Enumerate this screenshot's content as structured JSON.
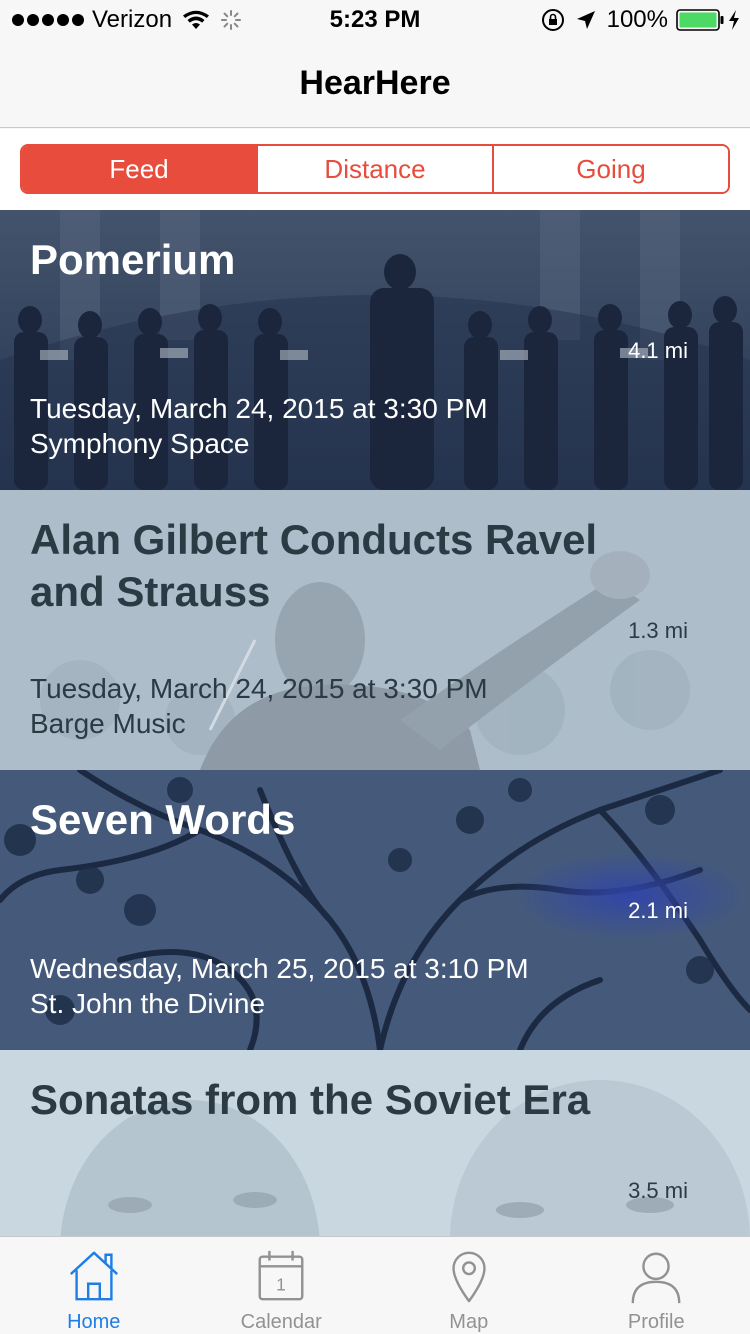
{
  "status_bar": {
    "carrier": "Verizon",
    "time": "5:23 PM",
    "battery": "100%"
  },
  "nav": {
    "title": "HearHere"
  },
  "segments": [
    {
      "label": "Feed",
      "selected": true
    },
    {
      "label": "Distance",
      "selected": false
    },
    {
      "label": "Going",
      "selected": false
    }
  ],
  "events": [
    {
      "title": "Pomerium",
      "distance": "4.1 mi",
      "date": "Tuesday, March 24, 2015 at 3:30 PM",
      "venue": "Symphony Space"
    },
    {
      "title": "Alan Gilbert Conducts Ravel and Strauss",
      "distance": "1.3 mi",
      "date": "Tuesday, March 24, 2015 at 3:30 PM",
      "venue": "Barge Music"
    },
    {
      "title": "Seven Words",
      "distance": "2.1 mi",
      "date": "Wednesday, March 25, 2015 at 3:10 PM",
      "venue": "St. John the Divine"
    },
    {
      "title": "Sonatas from the Soviet Era",
      "distance": "3.5 mi",
      "date": "",
      "venue": ""
    }
  ],
  "tabs": [
    {
      "label": "Home",
      "icon": "home-icon",
      "active": true
    },
    {
      "label": "Calendar",
      "icon": "calendar-icon",
      "active": false,
      "icon_text": "1"
    },
    {
      "label": "Map",
      "icon": "map-pin-icon",
      "active": false
    },
    {
      "label": "Profile",
      "icon": "profile-icon",
      "active": false
    }
  ],
  "colors": {
    "accent": "#e74c3c",
    "tab_active": "#1e7ee6",
    "tab_inactive": "#929292"
  }
}
